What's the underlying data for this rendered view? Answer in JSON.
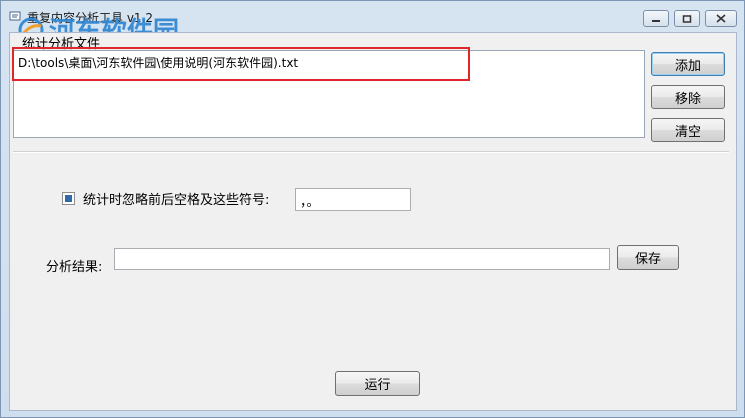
{
  "window": {
    "title": "重复内容分析工具 v1.2",
    "watermark": "河东软件园"
  },
  "file_group": {
    "label": "统计分析文件",
    "files": [
      "D:\\tools\\桌面\\河东软件园\\使用说明(河东软件园).txt"
    ],
    "buttons": {
      "add": "添加",
      "remove": "移除",
      "clear": "清空"
    }
  },
  "options": {
    "ignore_label": "统计时忽略前后空格及这些符号:",
    "ignore_checked": true,
    "symbols_value": "，。"
  },
  "result": {
    "label": "分析结果:",
    "value": "",
    "save_label": "保存"
  },
  "run_label": "运行",
  "colors": {
    "highlight": "#e0262b",
    "watermark": "#2f86d1"
  }
}
